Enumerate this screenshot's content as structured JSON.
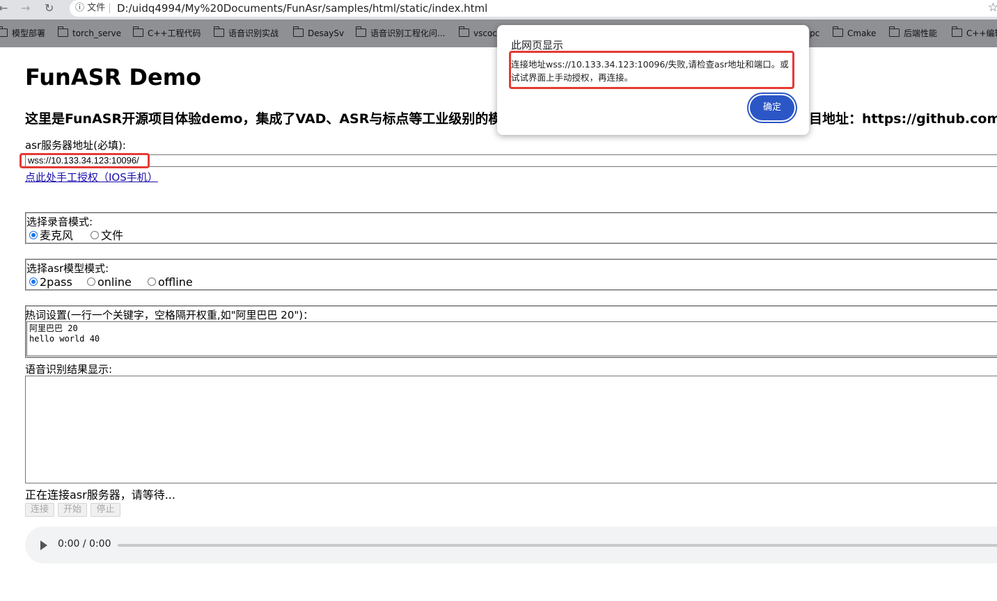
{
  "browser": {
    "url_chip": "文件",
    "url": "D:/uidq4994/My%20Documents/FunAsr/samples/html/static/index.html",
    "bookmarks": [
      "模型部署",
      "torch_serve",
      "C++工程代码",
      "语音识别实战",
      "DesaySv",
      "语音识别工程化问...",
      "vscoc",
      "pc",
      "Cmake",
      "后端性能",
      "C++编辑"
    ]
  },
  "page": {
    "title": "FunASR Demo",
    "subtitle_left": "这里是FunASR开源项目体验demo，集成了VAD、ASR与标点等工业级别的模型",
    "subtitle_right": "目地址：https://github.com/a",
    "server_label": "asr服务器地址(必填):",
    "server_value": "wss://10.133.34.123:10096/",
    "ios_link": "点此处手工授权（IOS手机）",
    "record_mode_label": "选择录音模式:",
    "record_modes": [
      "麦克风",
      "文件"
    ],
    "asr_mode_label": "选择asr模型模式:",
    "asr_modes": [
      "2pass",
      "online",
      "offline"
    ],
    "hotword_label": "热词设置(一行一个关键字，空格隔开权重,如\"阿里巴巴 20\")：",
    "hotwords": "阿里巴巴 20\nhello world 40",
    "result_label": "语音识别结果显示:",
    "status": "正在连接asr服务器，请等待...",
    "buttons": {
      "connect": "连接",
      "start": "开始",
      "stop": "停止"
    },
    "audio_time": "0:00 / 0:00"
  },
  "dialog": {
    "title": "此网页显示",
    "message": "连接地址wss://10.133.34.123:10096/失败,请检查asr地址和端口。或试试界面上手动授权，再连接。",
    "ok": "确定"
  },
  "colors": {
    "highlight": "#e53935",
    "ok_button": "#2b56c6",
    "link": "#1a0dab"
  }
}
